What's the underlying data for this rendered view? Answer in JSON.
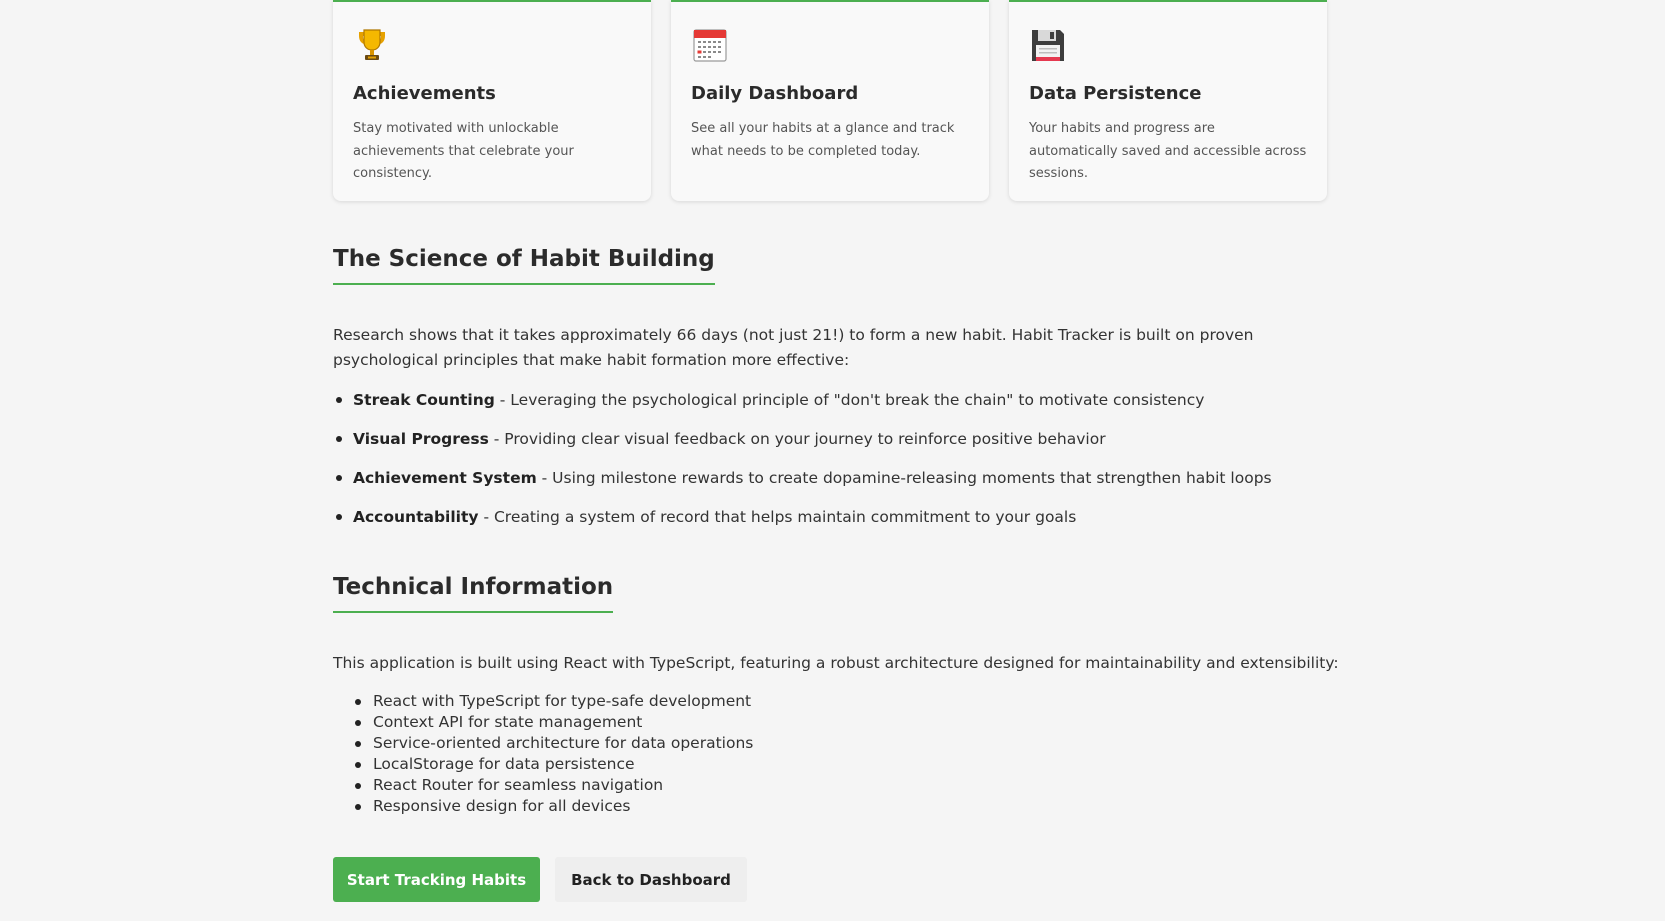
{
  "feature_cards": [
    {
      "icon": "trophy-icon",
      "title": "Achievements",
      "description": "Stay motivated with unlockable achievements that celebrate your consistency."
    },
    {
      "icon": "calendar-icon",
      "title": "Daily Dashboard",
      "description": "See all your habits at a glance and track what needs to be completed today."
    },
    {
      "icon": "floppy-disk-icon",
      "title": "Data Persistence",
      "description": "Your habits and progress are automatically saved and accessible across sessions."
    }
  ],
  "science": {
    "heading": "The Science of Habit Building",
    "intro": "Research shows that it takes approximately 66 days (not just 21!) to form a new habit. Habit Tracker is built on proven psychological principles that make habit formation more effective:",
    "principles": [
      {
        "term": "Streak Counting",
        "detail": " - Leveraging the psychological principle of \"don't break the chain\" to motivate consistency"
      },
      {
        "term": "Visual Progress",
        "detail": " - Providing clear visual feedback on your journey to reinforce positive behavior"
      },
      {
        "term": "Achievement System",
        "detail": " - Using milestone rewards to create dopamine-releasing moments that strengthen habit loops"
      },
      {
        "term": "Accountability",
        "detail": " - Creating a system of record that helps maintain commitment to your goals"
      }
    ]
  },
  "technical": {
    "heading": "Technical Information",
    "intro": "This application is built using React with TypeScript, featuring a robust architecture designed for maintainability and extensibility:",
    "items": [
      "React with TypeScript for type-safe development",
      "Context API for state management",
      "Service-oriented architecture for data operations",
      "LocalStorage for data persistence",
      "React Router for seamless navigation",
      "Responsive design for all devices"
    ]
  },
  "actions": {
    "primary_label": "Start Tracking Habits",
    "secondary_label": "Back to Dashboard"
  },
  "colors": {
    "accent": "#4caf50",
    "background": "#f5f5f5",
    "card_background": "#f9f9f9"
  }
}
